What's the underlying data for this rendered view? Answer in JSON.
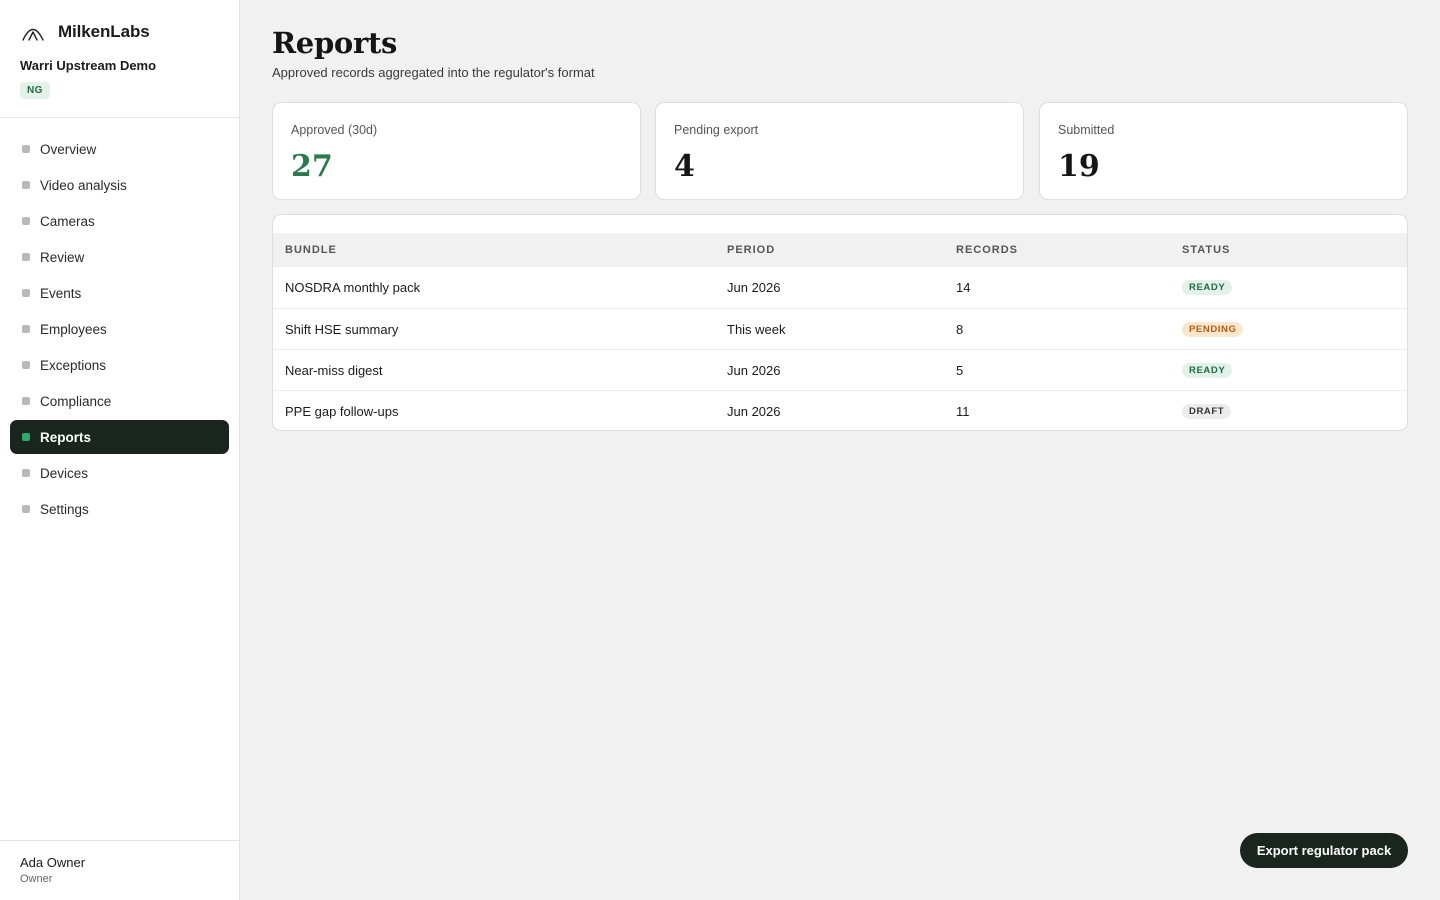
{
  "brand": {
    "name": "MilkenLabs",
    "icon": "mountain-arches-icon"
  },
  "org": {
    "name": "Warri Upstream Demo",
    "badge": "NG"
  },
  "nav": [
    {
      "label": "Overview",
      "active": false
    },
    {
      "label": "Video analysis",
      "active": false
    },
    {
      "label": "Cameras",
      "active": false
    },
    {
      "label": "Review",
      "active": false
    },
    {
      "label": "Events",
      "active": false
    },
    {
      "label": "Employees",
      "active": false
    },
    {
      "label": "Exceptions",
      "active": false
    },
    {
      "label": "Compliance",
      "active": false
    },
    {
      "label": "Reports",
      "active": true
    },
    {
      "label": "Devices",
      "active": false
    },
    {
      "label": "Settings",
      "active": false
    }
  ],
  "user": {
    "name": "Ada Owner",
    "role": "Owner"
  },
  "page": {
    "title": "Reports",
    "subtitle": "Approved records aggregated into the regulator's format"
  },
  "stats": [
    {
      "label": "Approved (30d)",
      "value": "27",
      "accent": "#2a7a4e"
    },
    {
      "label": "Pending export",
      "value": "4"
    },
    {
      "label": "Submitted",
      "value": "19"
    }
  ],
  "table": {
    "columns": [
      "BUNDLE",
      "PERIOD",
      "RECORDS",
      "STATUS"
    ],
    "rows": [
      {
        "bundle": "NOSDRA monthly pack",
        "period": "Jun 2026",
        "records": "14",
        "status": "READY",
        "status_kind": "ready"
      },
      {
        "bundle": "Shift HSE summary",
        "period": "This week",
        "records": "8",
        "status": "PENDING",
        "status_kind": "pending"
      },
      {
        "bundle": "Near-miss digest",
        "period": "Jun 2026",
        "records": "5",
        "status": "READY",
        "status_kind": "ready"
      },
      {
        "bundle": "PPE gap follow-ups",
        "period": "Jun 2026",
        "records": "11",
        "status": "DRAFT",
        "status_kind": "draft"
      }
    ]
  },
  "actions": {
    "export_label": "Export regulator pack"
  },
  "colors": {
    "sidebar_active_bg": "#1a2520",
    "accent_green": "#2faa66",
    "ready": "#1f6b44",
    "pending": "#b15d12"
  }
}
